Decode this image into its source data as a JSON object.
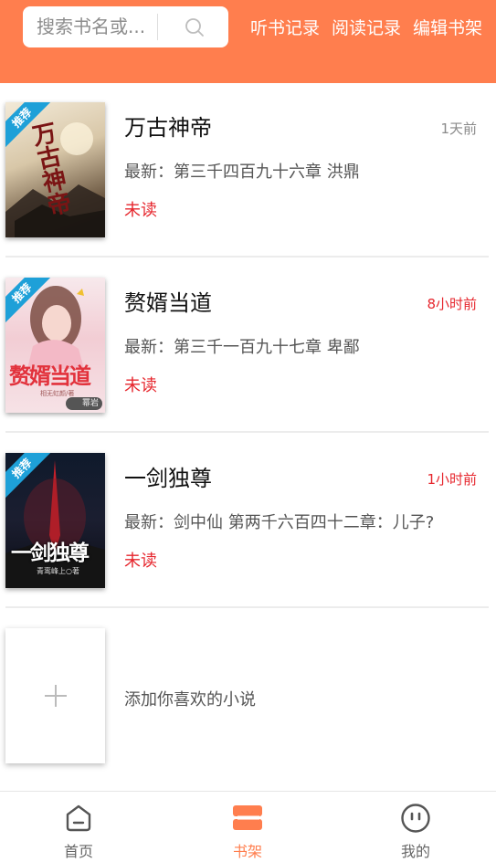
{
  "header": {
    "search_placeholder": "搜索书名或...",
    "links": [
      "听书记录",
      "阅读记录",
      "编辑书架"
    ]
  },
  "books": [
    {
      "title": "万古神帝",
      "time": "1天前",
      "time_color": "#8a8a8a",
      "latest": "最新：第三千四百九十六章 洪鼎",
      "status": "未读",
      "badge": "推荐",
      "cover_text": "万古神帝"
    },
    {
      "title": "赘婿当道",
      "time": "8小时前",
      "time_color": "#e6262d",
      "latest": "最新：第三千一百九十七章 卑鄙",
      "status": "未读",
      "badge": "推荐",
      "cover_text": "赘婿当道",
      "cover_author": "相无虹颜/著",
      "cover_tag": "幂岩"
    },
    {
      "title": "一剑独尊",
      "time": "1小时前",
      "time_color": "#e6262d",
      "latest": "最新：剑中仙 第两千六百四十二章：儿子?",
      "status": "未读",
      "badge": "推荐",
      "cover_text": "一剑独尊",
      "cover_author": "青鸾峰上○著"
    }
  ],
  "add": {
    "label": "添加你喜欢的小说"
  },
  "nav": [
    {
      "label": "首页",
      "icon": "home-icon",
      "active": false
    },
    {
      "label": "书架",
      "icon": "bookshelf-icon",
      "active": true
    },
    {
      "label": "我的",
      "icon": "profile-icon",
      "active": false
    }
  ],
  "colors": {
    "accent": "#ff7e4e",
    "unread": "#e6262d",
    "badge": "#1ea0d8"
  }
}
